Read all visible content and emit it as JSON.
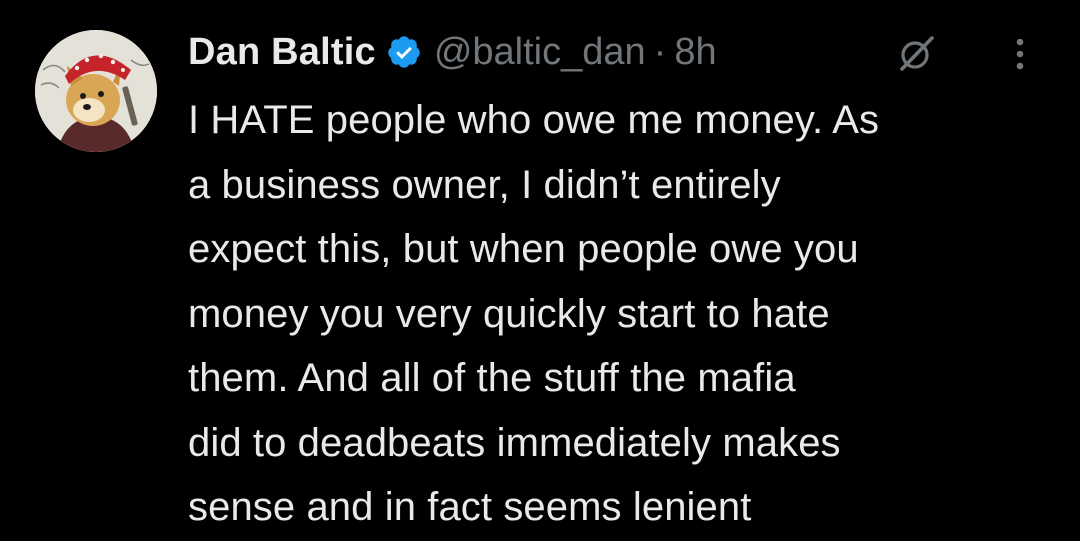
{
  "tweet": {
    "author": {
      "display_name": "Dan Baltic",
      "handle": "@baltic_dan",
      "verified": true,
      "avatar_icon": "doge-avatar-icon"
    },
    "separator": "·",
    "timestamp": "8h",
    "text_lines": [
      "I HATE people who owe me money. As",
      "a business owner, I didn’t entirely",
      "expect this, but when people owe you",
      "money you very quickly start to hate",
      "them. And all of the stuff the mafia",
      "did to deadbeats immediately makes",
      "sense and in fact seems lenient"
    ]
  },
  "icons": {
    "verified": "verified-badge-icon",
    "grok": "grok-icon",
    "more": "more-options-icon"
  },
  "colors": {
    "background": "#000000",
    "primary_text": "#e7e9ea",
    "secondary_text": "#71767b",
    "verified_blue": "#1d9bf0"
  }
}
